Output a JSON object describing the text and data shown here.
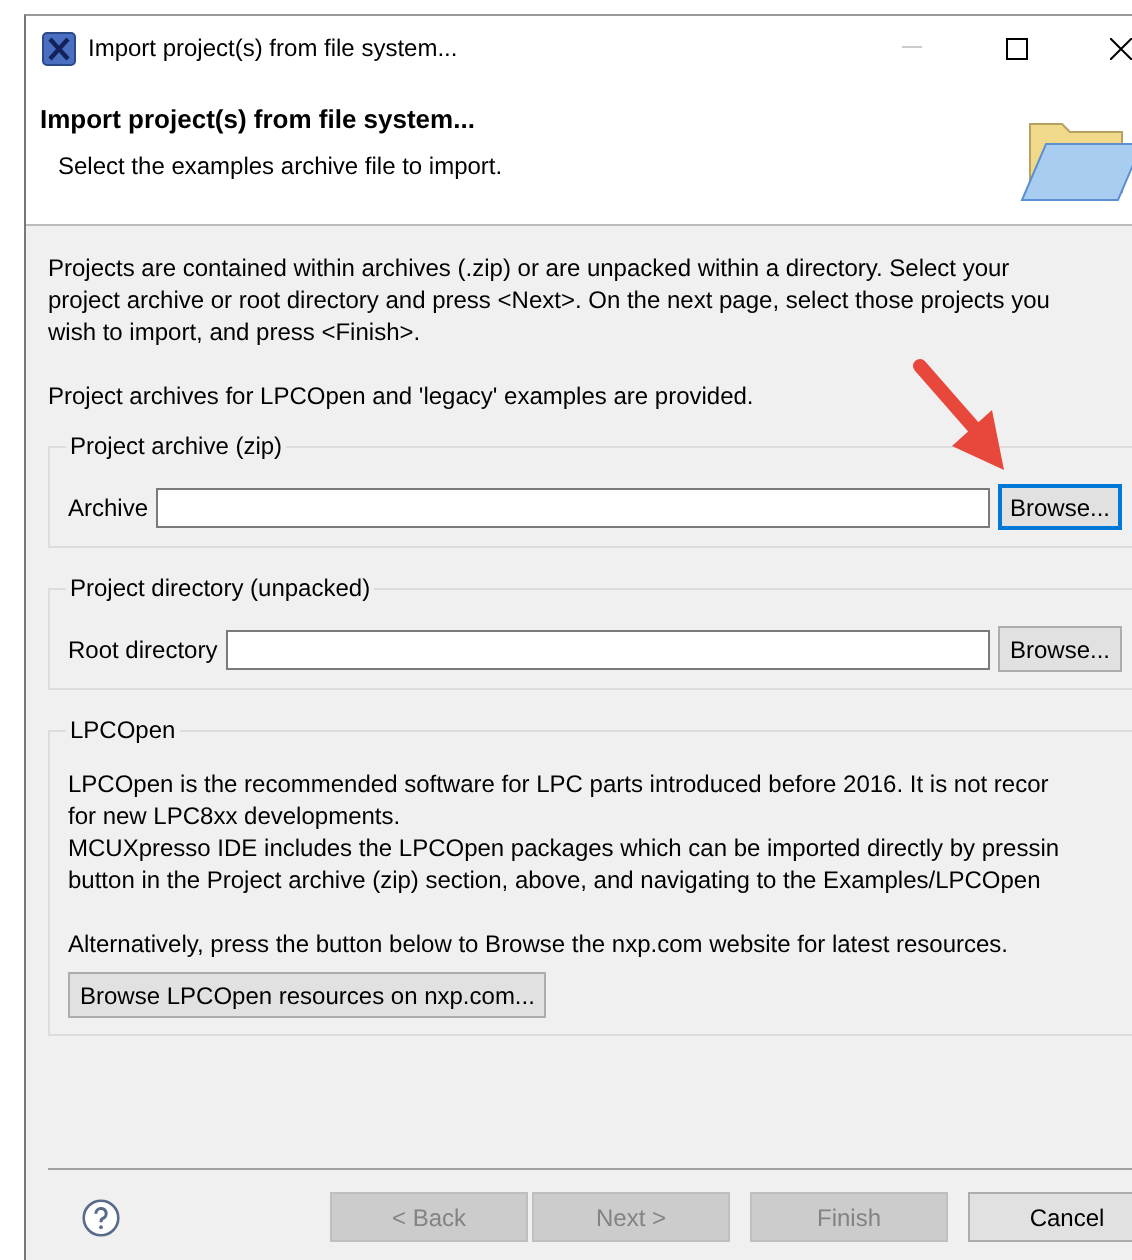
{
  "window": {
    "title": "Import project(s) from file system..."
  },
  "header": {
    "title": "Import project(s) from file system...",
    "subtitle": "Select the examples archive file to import."
  },
  "intro": {
    "lines": [
      "Projects are contained within archives (.zip) or are unpacked within a directory. Select your",
      "project archive or root directory and press <Next>. On the next page, select those projects you",
      "wish to import, and press <Finish>."
    ]
  },
  "note": "Project archives for LPCOpen and 'legacy' examples are provided.",
  "groups": [
    {
      "title": "Project archive (zip)",
      "label": "Archive",
      "browse": "Browse...",
      "focused": true
    },
    {
      "title": "Project directory (unpacked)",
      "label": "Root directory",
      "browse": "Browse...",
      "focused": false
    }
  ],
  "lpcopen": {
    "title": "LPCOpen",
    "lines": [
      "LPCOpen is the recommended software for LPC parts introduced before 2016. It is not recor",
      "for new LPC8xx developments.",
      "MCUXpresso IDE includes the LPCOpen packages which can be imported directly by pressin",
      "button in the Project archive (zip) section, above, and navigating to the Examples/LPCOpen"
    ],
    "alternative": "Alternatively, press the button below to Browse the nxp.com website for latest resources.",
    "button": "Browse LPCOpen resources on nxp.com..."
  },
  "buttons": [
    {
      "label": "< Back",
      "disabled": true
    },
    {
      "label": "Next >",
      "disabled": true
    },
    {
      "label": "Finish",
      "disabled": true
    },
    {
      "label": "Cancel",
      "disabled": false
    }
  ]
}
